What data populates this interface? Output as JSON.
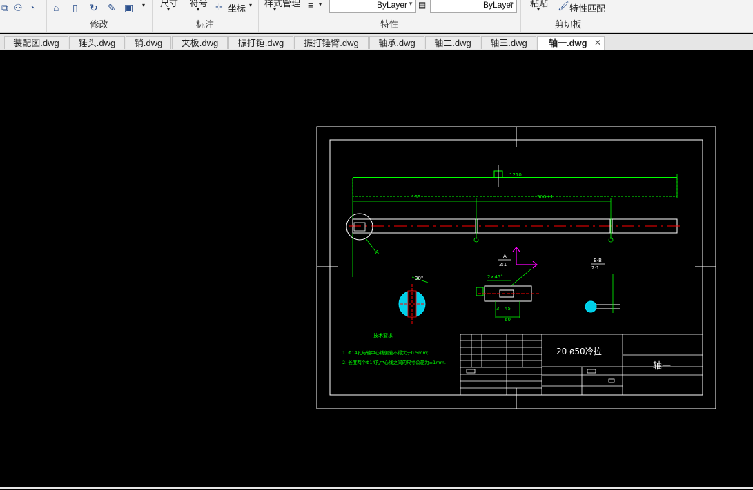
{
  "ribbon": {
    "modify_label": "修改",
    "annotation_label": "标注",
    "annotation_dim": "尺寸",
    "annotation_symbol": "符号",
    "annotation_coord": "坐标",
    "properties_label": "特性",
    "style_manager": "样式管理",
    "linetype_value": "ByLayer",
    "lineweight_value": "ByLayer",
    "clipboard_label": "剪切板",
    "paste_label": "粘贴",
    "match_props_label": "特性匹配"
  },
  "tabs": [
    {
      "label": "装配图.dwg"
    },
    {
      "label": "锤头.dwg"
    },
    {
      "label": "销.dwg"
    },
    {
      "label": "夹板.dwg"
    },
    {
      "label": "振打锤.dwg"
    },
    {
      "label": "振打锤臂.dwg"
    },
    {
      "label": "轴承.dwg"
    },
    {
      "label": "轴二.dwg"
    },
    {
      "label": "轴三.dwg"
    },
    {
      "label": "轴一.dwg",
      "active": true
    }
  ],
  "drawing": {
    "dim_total": "1210",
    "dim_left": "165",
    "dim_right": "500±1",
    "detail_a_label": "A",
    "detail_a_scale": "2:1",
    "section_bb_label": "B-B",
    "section_bb_scale": "2:1",
    "chamfer": "2×45°",
    "angle": "30°",
    "dim_60": "60",
    "dim_45": "45",
    "dim_3": "3",
    "tech_req_title": "技术要求",
    "tech_req_1": "1. Φ14孔与轴中心线偏差不得大于0.5mm;",
    "tech_req_2": "2. 长度两个Φ14孔中心线之间的尺寸公差为±1mm.",
    "title_material": "20  ø50冷拉",
    "title_name": "轴一"
  },
  "colors": {
    "ribbon_bg": "#f3f3f3",
    "canvas_bg": "#000000",
    "cad_green": "#00ff00",
    "cad_white": "#ffffff",
    "cad_red": "#ff0000",
    "cad_cyan": "#00e5ff",
    "cad_magenta": "#ff00ff"
  }
}
